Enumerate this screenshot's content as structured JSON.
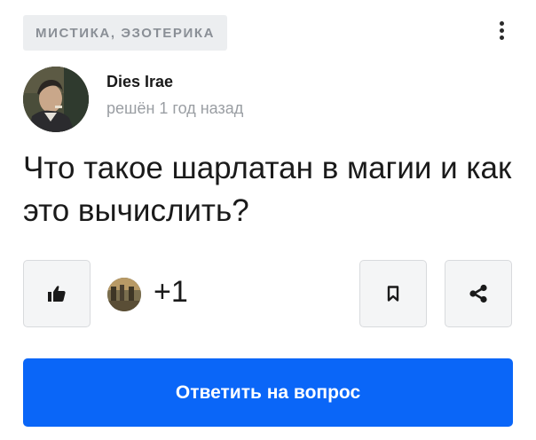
{
  "category": {
    "label": "МИСТИКА, ЭЗОТЕРИКА"
  },
  "menu": {
    "icon": "more-vertical-icon"
  },
  "author": {
    "name": "Dies Irae",
    "status": "решён 1 год назад"
  },
  "question": {
    "title": "Что такое шарлатан в магии и как это вычислить?"
  },
  "actions": {
    "like_icon": "thumbs-up-icon",
    "likes_count": "+1",
    "bookmark_icon": "bookmark-icon",
    "share_icon": "share-icon",
    "answer_label": "Ответить на вопрос"
  },
  "colors": {
    "accent": "#0a66f8",
    "tag_background": "#eceef0",
    "tag_text": "#8a8f96",
    "muted_text": "#9a9ea3"
  }
}
